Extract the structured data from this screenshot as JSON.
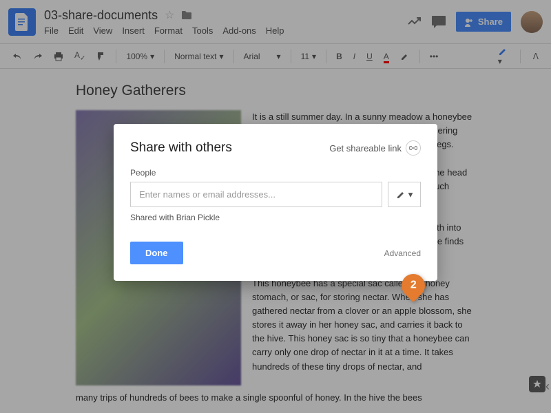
{
  "header": {
    "doc_title": "03-share-documents",
    "menu": {
      "file": "File",
      "edit": "Edit",
      "view": "View",
      "insert": "Insert",
      "format": "Format",
      "tools": "Tools",
      "addons": "Add-ons",
      "help": "Help"
    },
    "share_label": "Share"
  },
  "toolbar": {
    "zoom": "100%",
    "style": "Normal text",
    "font": "Arial",
    "size": "11"
  },
  "document": {
    "heading": "Honey Gatherers",
    "para1": "It is a still summer day. In a sunny meadow a honeybee is hovering. She flies from flower to flower gathering nectar in her honey stomach, or pollen on her legs.",
    "para2": "She lights upon blooming clover. It seems on the head of the clover she finds a drop of nectar after much searching.",
    "para3": "She thrusts her long, tube-like tongue like mouth into the depth of one and sucks up sweet nectar she finds waiting.",
    "para4": "This honeybee has a special sac called the honey stomach, or sac, for storing nectar. When she has gathered nectar from a clover or an apple blossom, she stores it away in her honey sac, and carries it back to the hive. This honey sac is so tiny that a honeybee can carry only one drop of nectar in it at a time. It takes hundreds of these tiny drops of nectar, and",
    "para5": "many trips of hundreds of bees to make a single spoonful of honey. In the hive the bees"
  },
  "dialog": {
    "title": "Share with others",
    "shareable_link": "Get shareable link",
    "people_label": "People",
    "people_placeholder": "Enter names or email addresses...",
    "shared_with": "Shared with Brian Pickle",
    "done": "Done",
    "advanced": "Advanced"
  },
  "callout": {
    "number": "2"
  }
}
